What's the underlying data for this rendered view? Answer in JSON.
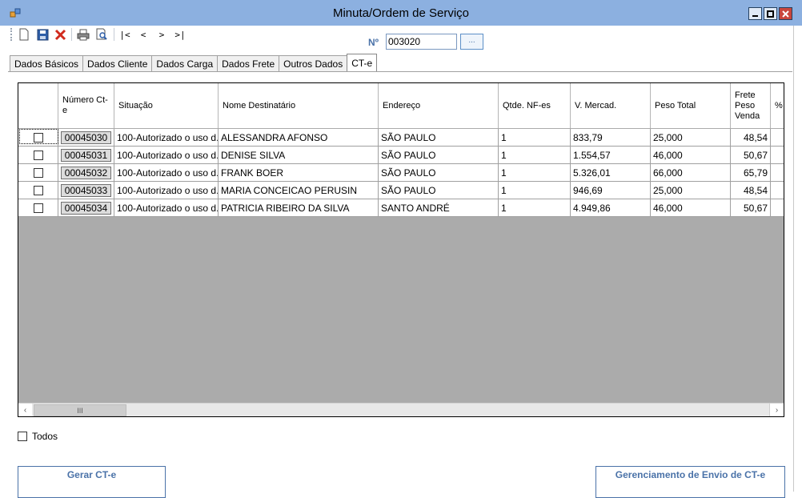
{
  "window": {
    "title": "Minuta/Ordem de Serviço"
  },
  "toolbar": {
    "buttons": [
      "new-document-icon",
      "save-icon",
      "delete-icon",
      "print-icon",
      "print-preview-icon"
    ],
    "nav": {
      "first": "|<",
      "prev": "<",
      "next": ">",
      "last": ">|"
    }
  },
  "number": {
    "label": "Nº",
    "value": "003020",
    "lookup": "..."
  },
  "tabs": [
    {
      "label": "Dados Básicos"
    },
    {
      "label": "Dados Cliente"
    },
    {
      "label": "Dados Carga"
    },
    {
      "label": "Dados Frete"
    },
    {
      "label": "Outros Dados"
    },
    {
      "label": "CT-e",
      "active": true
    }
  ],
  "grid": {
    "headers": {
      "numero": "Número Ct-e",
      "situacao": "Situação",
      "destinatario": "Nome Destinatário",
      "endereco": "Endereço",
      "qtde": "Qtde. NF-es",
      "vmercad": "V. Mercad.",
      "peso": "Peso Total",
      "frete": "Frete Peso Venda",
      "pct": "% Ve"
    },
    "rows": [
      {
        "numero": "00045030",
        "situacao": "100-Autorizado o uso d...",
        "destinatario": "ALESSANDRA AFONSO",
        "endereco": "SÃO PAULO",
        "qtde": "1",
        "vmercad": "833,79",
        "peso": "25,000",
        "frete": "48,54"
      },
      {
        "numero": "00045031",
        "situacao": "100-Autorizado o uso d...",
        "destinatario": "DENISE SILVA",
        "endereco": "SÃO PAULO",
        "qtde": "1",
        "vmercad": "1.554,57",
        "peso": "46,000",
        "frete": "50,67"
      },
      {
        "numero": "00045032",
        "situacao": "100-Autorizado o uso d...",
        "destinatario": "FRANK BOER",
        "endereco": "SÃO PAULO",
        "qtde": "1",
        "vmercad": "5.326,01",
        "peso": "66,000",
        "frete": "65,79"
      },
      {
        "numero": "00045033",
        "situacao": "100-Autorizado o uso d...",
        "destinatario": "MARIA CONCEICAO PERUSIN",
        "endereco": "SÃO PAULO",
        "qtde": "1",
        "vmercad": "946,69",
        "peso": "25,000",
        "frete": "48,54"
      },
      {
        "numero": "00045034",
        "situacao": "100-Autorizado o uso d...",
        "destinatario": "PATRICIA RIBEIRO DA SILVA",
        "endereco": "SANTO ANDRÉ",
        "qtde": "1",
        "vmercad": "4.949,86",
        "peso": "46,000",
        "frete": "50,67"
      }
    ],
    "scroll_thumb": "III"
  },
  "todos": {
    "label": "Todos"
  },
  "actions": {
    "gerar": "Gerar CT-e",
    "gerenciamento": "Gerenciamento de Envio de CT-e"
  }
}
